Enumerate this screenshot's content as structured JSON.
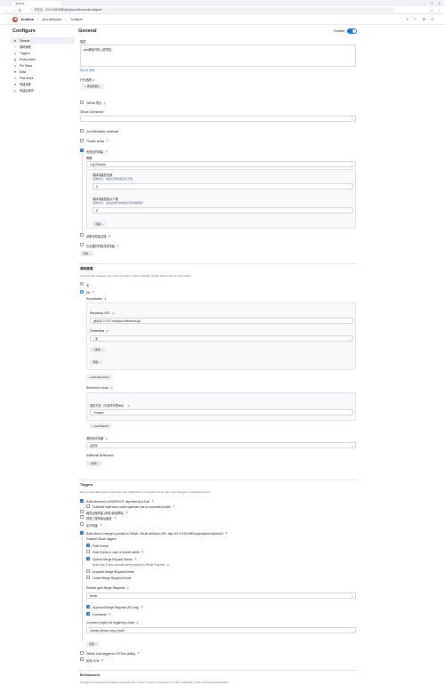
{
  "browser": {
    "tab_title": "Jenkins",
    "url_badge": "不安全",
    "url": "10.0.0.83:8080/job/java-helloworld/configure/"
  },
  "header": {
    "brand": "Jenkins",
    "breadcrumbs": [
      "java-helloworld",
      "Configure"
    ]
  },
  "sidebar": {
    "title": "Configure",
    "items": [
      {
        "label": "General",
        "icon": "gear-icon"
      },
      {
        "label": "源码管理",
        "icon": "branch-icon"
      },
      {
        "label": "Triggers",
        "icon": "clock-icon"
      },
      {
        "label": "Environment",
        "icon": "globe-icon"
      },
      {
        "label": "Pre Steps",
        "icon": "list-icon"
      },
      {
        "label": "Build",
        "icon": "hammer-icon"
      },
      {
        "label": "Post Steps",
        "icon": "list-icon"
      },
      {
        "label": "构建设置",
        "icon": "gear-icon"
      },
      {
        "label": "构建后操作",
        "icon": "cube-icon"
      }
    ]
  },
  "general": {
    "title": "General",
    "enabled_label": "Enabled",
    "desc_label": "描述",
    "desc_value": "java程序代码上线项目",
    "preview": "预览",
    "plain_text": "纯文本",
    "view_link": "查看",
    "prop_label": "行为追踪入",
    "add_button": "添加标题入",
    "github_project": "GitHub 项目",
    "gitlab_connection_label": "GitLab Connection",
    "gitlab_connection_value": "",
    "alt_credential": "Use alternative credential",
    "throttle": "Throttle builds",
    "discard_old": "丢弃旧的构建",
    "strategy_label": "策略",
    "strategy_value": "Log Rotation",
    "keep_days_label": "保持构建的天数",
    "keep_days_hint": "如果非空，构建记录将保存此天数",
    "keep_days_value": "5",
    "keep_max_label": "保持构建的最大个数",
    "keep_max_hint": "如果非空，最多此数目的构建记录将被保存",
    "keep_max_value": "5",
    "advanced": "高级",
    "param_build": "参数化构建过程",
    "concurrent": "在必要的时候并发构建",
    "advanced2": "高级"
  },
  "scm": {
    "title": "源码管理",
    "desc": "Connect and manage your code repository to automatically pull the latest code for your builds.",
    "none": "无",
    "git": "Git",
    "repositories": "Repositories",
    "repo_url_label": "Repository URL",
    "repo_url_value": "git@10.0.0.97:root/java-helloworld.git",
    "credentials_label": "Credentials",
    "credentials_value": "- 无 -",
    "add_cred": "添加",
    "advanced": "高级",
    "add_repo": "Add Repository",
    "branches_label": "Branches to build",
    "branch_spec_label": "指定分支（为空时代表any）",
    "branch_spec_value": "*/master",
    "add_branch": "Add Branch",
    "browser_label": "源码库浏览器",
    "browser_value": "(自动)",
    "additional": "Additional Behaviours",
    "add_new": "新增"
  },
  "triggers": {
    "title": "Triggers",
    "desc": "Set up automated actions that start your build based on specific events, like code changes or scheduled times.",
    "items": [
      {
        "label": "Build whenever a SNAPSHOT dependency is built",
        "checked": true
      },
      {
        "label": "Schedule build when some upstream has no successful builds",
        "checked": false
      },
      {
        "label": "触发远程构建 (例如,使用脚本)",
        "checked": false
      },
      {
        "label": "其他工程构建后触发",
        "checked": false
      },
      {
        "label": "定时构建",
        "checked": false
      },
      {
        "label": "Build when a change is pushed to GitLab. GitLab webhook URL: http://10.0.0.83:8080/project/java-helloworld",
        "checked": true
      }
    ],
    "enabled_triggers": "Enabled GitLab triggers",
    "sub": [
      {
        "label": "Push Events",
        "checked": true
      },
      {
        "label": "Push Events in case of branch delete",
        "checked": false
      },
      {
        "label": "Opened Merge Request Events",
        "checked": true
      },
      {
        "label": "Build only if new commits were pushed to Merge Request",
        "checked": false
      },
      {
        "label": "Accepted Merge Request Events",
        "checked": false
      },
      {
        "label": "Closed Merge Request Events",
        "checked": false
      }
    ],
    "rebuild_label": "Rebuild open Merge Requests",
    "rebuild_value": "Never",
    "approved": "Approved Merge Requests (EE-only)",
    "comments": "Comments",
    "comment_regex_label": "Comment (regex) for triggering a build",
    "comment_regex_value": "Jenkins please retry a build",
    "advanced": "高级",
    "hook": "GitHub hook trigger for GITScm polling",
    "poll": "轮询 SCM"
  },
  "environment": {
    "title": "Environment",
    "desc": "Configure settings and variables that define the context in which your build runs, like credentials, paths, and global parameters."
  }
}
